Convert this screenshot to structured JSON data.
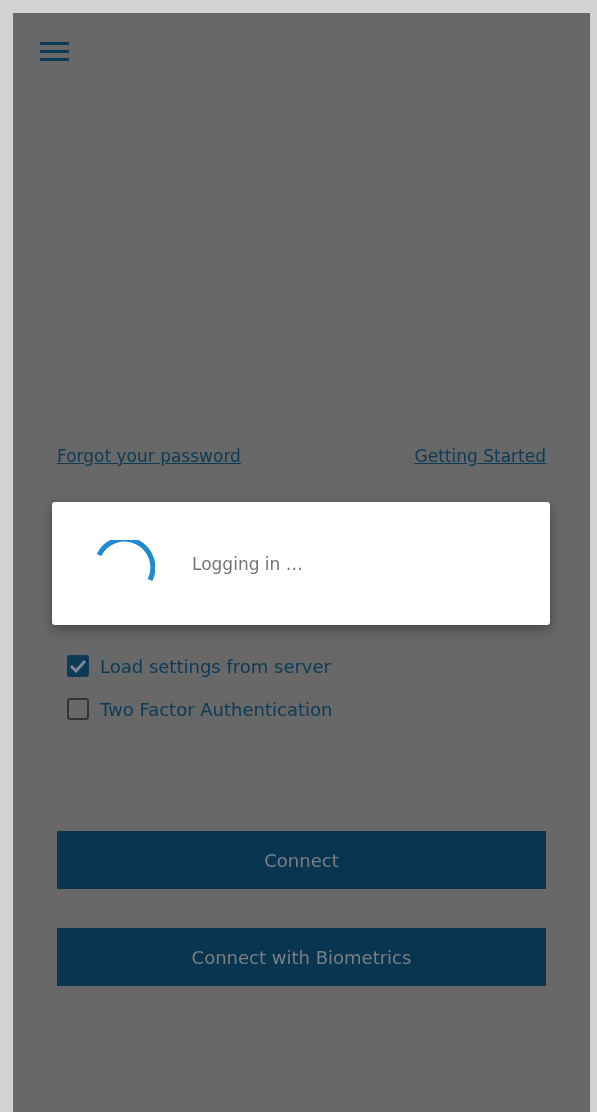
{
  "links": [
    {
      "label": "Forgot your password"
    },
    {
      "label": "Getting Started"
    }
  ],
  "options": [
    {
      "label": "Load settings from server",
      "checked": true
    },
    {
      "label": "Two Factor Authentication",
      "checked": false
    }
  ],
  "buttons": [
    {
      "label": "Connect"
    },
    {
      "label": "Connect with Biometrics"
    }
  ],
  "dialog": {
    "message": "Logging in …"
  }
}
